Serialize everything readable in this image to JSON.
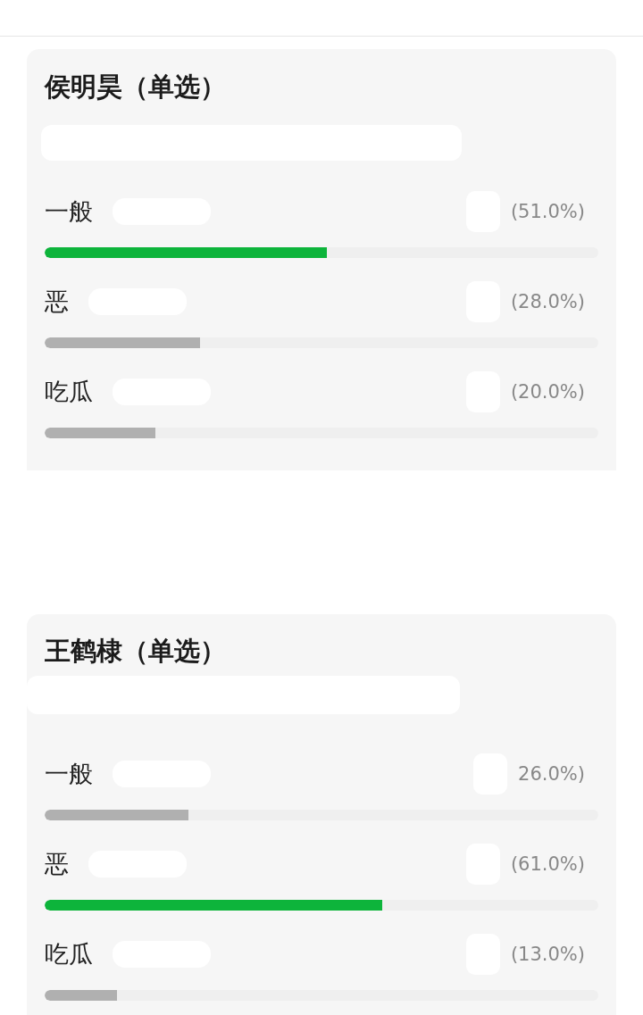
{
  "polls": [
    {
      "title": "侯明昊（单选）",
      "options": [
        {
          "label": "一般",
          "percent": "(51.0%)",
          "level": 0.51,
          "selected": true
        },
        {
          "label": "恶",
          "percent": "(28.0%)",
          "level": 0.28,
          "selected": false
        },
        {
          "label": "吃瓜",
          "percent": "(20.0%)",
          "level": 0.2,
          "selected": false
        }
      ]
    },
    {
      "title": "王鹤棣（单选）",
      "options": [
        {
          "label": "一般",
          "percent": "26.0%)",
          "level": 0.26,
          "selected": false
        },
        {
          "label": "恶",
          "percent": "(61.0%)",
          "level": 0.61,
          "selected": true
        },
        {
          "label": "吃瓜",
          "percent": "(13.0%)",
          "level": 0.13,
          "selected": false
        }
      ]
    }
  ]
}
